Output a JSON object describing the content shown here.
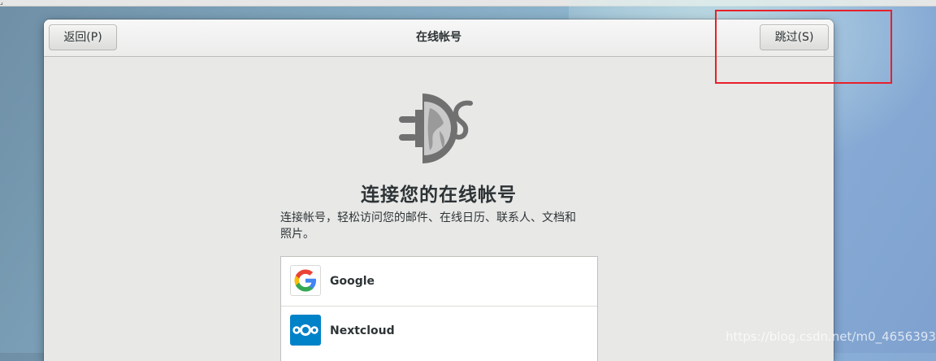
{
  "window": {
    "title": "在线帐号",
    "back_label": "返回(P)",
    "skip_label": "跳过(S)"
  },
  "page": {
    "hero_icon": "online-accounts-plug-icon",
    "heading": "连接您的在线帐号",
    "description_line1": "连接帐号，轻松访问您的邮件、在线日历、联系人、文档和",
    "description_line2": "照片。"
  },
  "providers": [
    {
      "name": "Google",
      "icon": "google-icon"
    },
    {
      "name": "Nextcloud",
      "icon": "nextcloud-icon"
    }
  ],
  "watermark": "https://blog.csdn.net/m0_46563938",
  "colors": {
    "highlight": "#e8202a",
    "nextcloud": "#0082c9"
  }
}
